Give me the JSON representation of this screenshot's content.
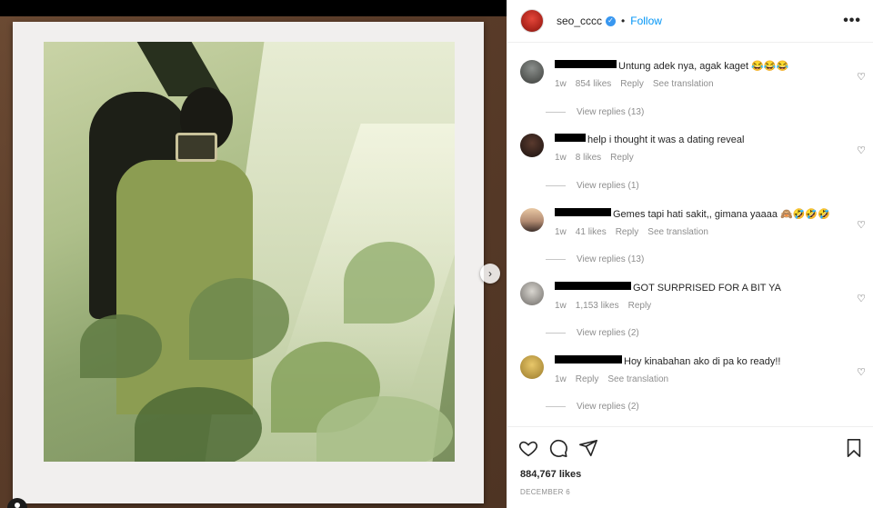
{
  "post": {
    "username": "seo_cccc",
    "separator": "•",
    "follow_label": "Follow",
    "more_label": "•••",
    "next_label": "›",
    "likes": "884,767 likes",
    "date": "DECEMBER 6"
  },
  "comments": [
    {
      "text": "Untung adek nya, agak kaget 😂😂😂",
      "time": "1w",
      "likes": "854 likes",
      "reply": "Reply",
      "translate": "See translation",
      "replies": "View replies (13)"
    },
    {
      "text": "help i thought it was a dating reveal",
      "time": "1w",
      "likes": "8 likes",
      "reply": "Reply",
      "translate": "",
      "replies": "View replies (1)"
    },
    {
      "text": "Gemes tapi hati sakit,, gimana yaaaa 🙈🤣🤣🤣",
      "time": "1w",
      "likes": "41 likes",
      "reply": "Reply",
      "translate": "See translation",
      "replies": "View replies (13)"
    },
    {
      "text": "GOT SURPRISED FOR A BIT YA",
      "time": "1w",
      "likes": "1,153 likes",
      "reply": "Reply",
      "translate": "",
      "replies": "View replies (2)"
    },
    {
      "text": "Hoy kinabahan ako di pa ko ready!!",
      "time": "1w",
      "likes": "",
      "reply": "Reply",
      "translate": "See translation",
      "replies": "View replies (2)"
    }
  ],
  "icons": {
    "heart": "heart-icon",
    "comment": "comment-icon",
    "share": "paper-plane-icon",
    "save": "bookmark-icon",
    "verified": "verified-badge-icon",
    "next": "chevron-right-icon"
  },
  "colors": {
    "accent": "#0095f6",
    "verified": "#3897f0",
    "muted": "#8e8e8e"
  }
}
